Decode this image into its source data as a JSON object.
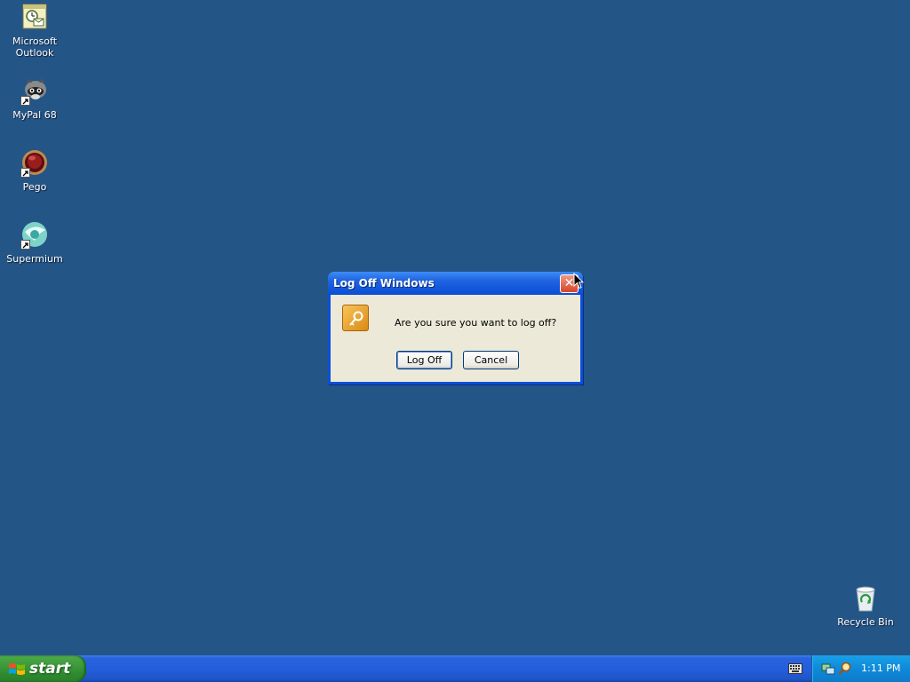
{
  "desktop": {
    "background_color": "#245587",
    "icons": [
      {
        "label": "Microsoft\nOutlook",
        "icon": "outlook-icon"
      },
      {
        "label": "MyPal 68",
        "icon": "mypal-icon"
      },
      {
        "label": "Pego",
        "icon": "pego-icon"
      },
      {
        "label": "Supermium",
        "icon": "supermium-icon"
      },
      {
        "label": "Recycle Bin",
        "icon": "recycle-bin-icon"
      }
    ]
  },
  "dialog": {
    "title": "Log Off Windows",
    "message": "Are you sure you want to log off?",
    "logoff_label": "Log Off",
    "cancel_label": "Cancel",
    "close_glyph": "✕",
    "icon": "key-icon"
  },
  "taskbar": {
    "start_label": "start",
    "clock": "1:11 PM",
    "tray_icons": [
      "network-icon",
      "search-icon"
    ],
    "keyboard_icon": "keyboard-icon"
  }
}
